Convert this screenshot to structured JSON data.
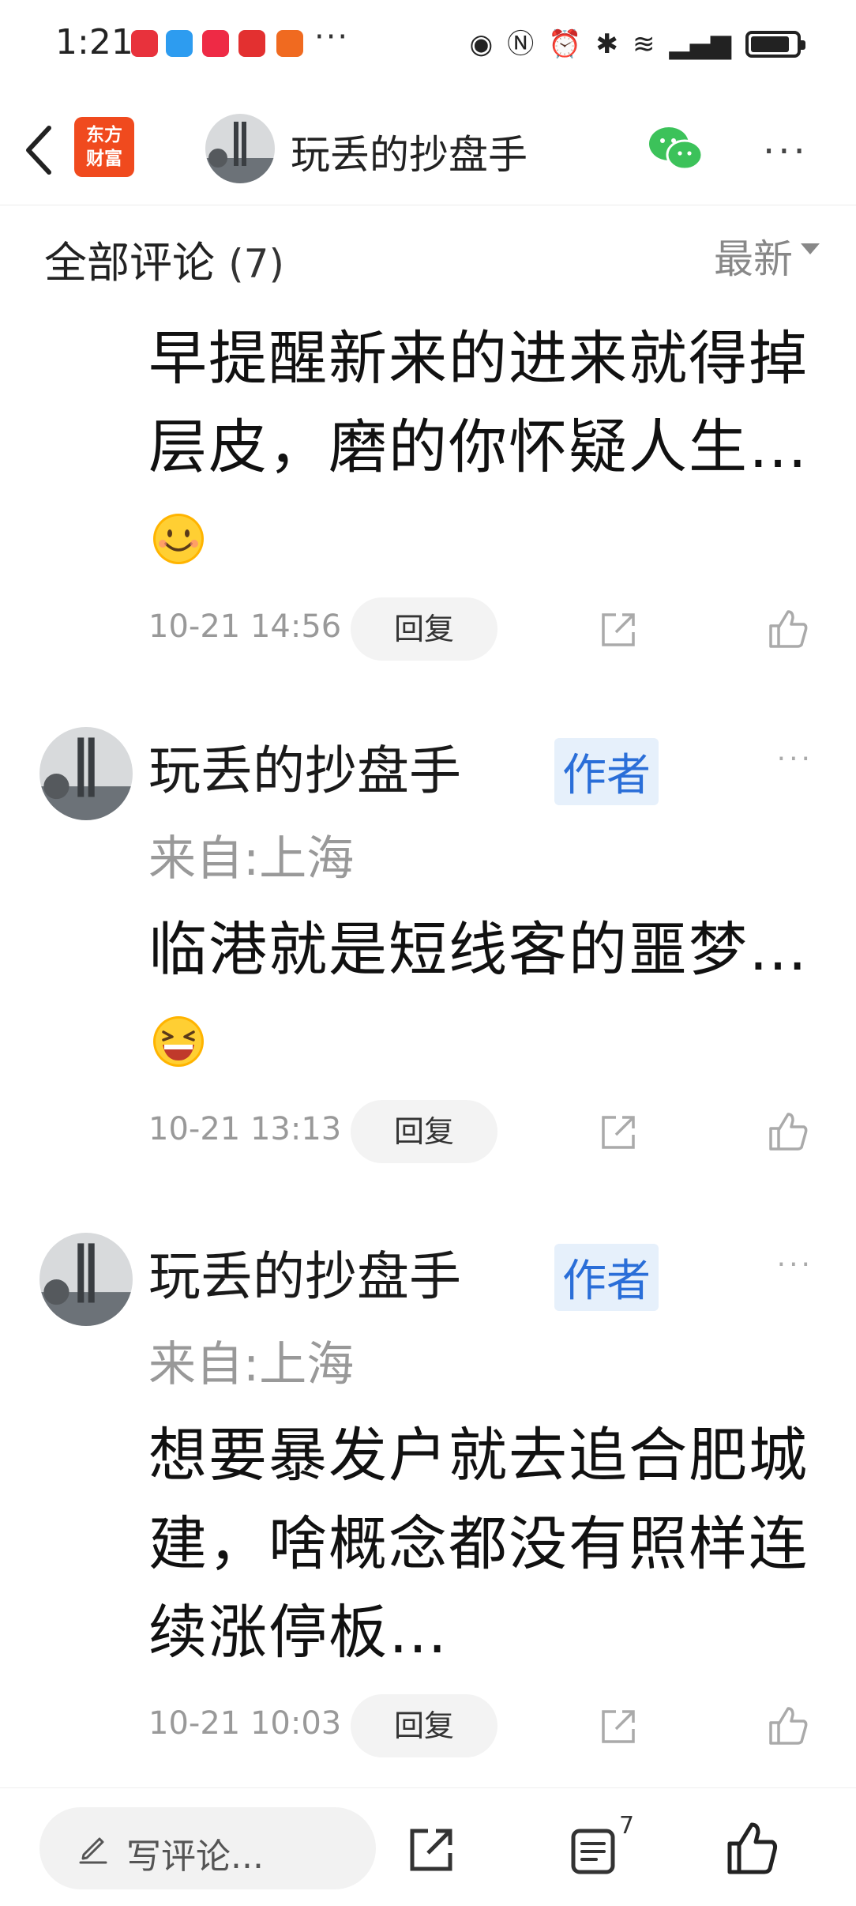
{
  "status_bar": {
    "time": "1:21",
    "more_notifications": "···"
  },
  "nav": {
    "app_logo_line1": "东方",
    "app_logo_line2": "财富",
    "title": "玩丢的抄盘手",
    "more": "···"
  },
  "comments_header": {
    "title": "全部评论",
    "count": "(7)",
    "sort": "最新"
  },
  "comments": [
    {
      "text": "早提醒新来的进来就得掉层皮，磨的你怀疑人生…",
      "emoji": "smile",
      "time": "10-21 14:56",
      "reply": "回复"
    },
    {
      "author": "玩丢的抄盘手",
      "badge": "作者",
      "location": "来自:上海",
      "text": "临港就是短线客的噩梦…",
      "emoji": "laugh",
      "time": "10-21 13:13",
      "reply": "回复",
      "more": "···"
    },
    {
      "author": "玩丢的抄盘手",
      "badge": "作者",
      "location": "来自:上海",
      "text": "想要暴发户就去追合肥城建，啥概念都没有照样连续涨停板…",
      "time": "10-21 10:03",
      "reply": "回复",
      "more": "···"
    }
  ],
  "bottom_bar": {
    "placeholder": "写评论...",
    "comment_count": "7"
  },
  "colors": {
    "accent_blue": "#2a6ed8",
    "brand_orange": "#f04a1e",
    "wechat_green": "#3cc25a",
    "muted_gray": "#999999"
  }
}
